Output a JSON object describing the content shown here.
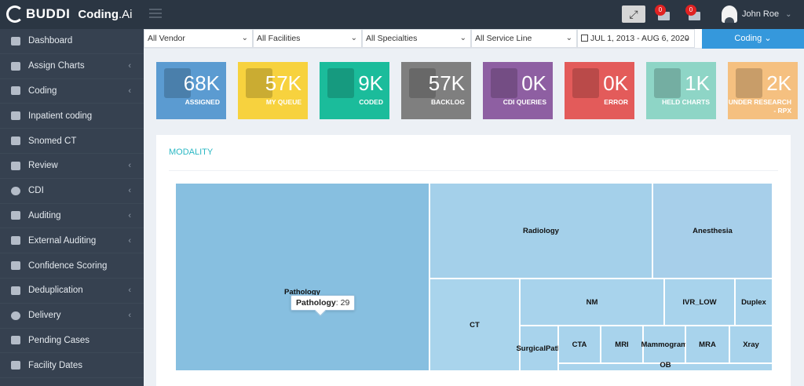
{
  "brand": {
    "name": "BUDDI",
    "product_main": "Coding",
    "product_suffix": ".Ai"
  },
  "header": {
    "notifications": [
      {
        "count": "0",
        "icon": "inbox-icon"
      },
      {
        "count": "0",
        "icon": "tasks-icon"
      }
    ],
    "user_name": "John Roe"
  },
  "sidebar": {
    "items": [
      {
        "label": "Dashboard",
        "icon": "dashboard-icon",
        "has_arrow": false
      },
      {
        "label": "Assign Charts",
        "icon": "list-icon",
        "has_arrow": true
      },
      {
        "label": "Coding",
        "icon": "check-square-icon",
        "has_arrow": true
      },
      {
        "label": "Inpatient coding",
        "icon": "file-icon",
        "has_arrow": false
      },
      {
        "label": "Snomed CT",
        "icon": "file-icon",
        "has_arrow": false
      },
      {
        "label": "Review",
        "icon": "edit-icon",
        "has_arrow": true
      },
      {
        "label": "CDI",
        "icon": "exclamation-circle-icon",
        "has_arrow": true
      },
      {
        "label": "Auditing",
        "icon": "thumbs-up-icon",
        "has_arrow": true
      },
      {
        "label": "External Auditing",
        "icon": "thumbs-up-icon",
        "has_arrow": true
      },
      {
        "label": "Confidence Scoring",
        "icon": "file-icon",
        "has_arrow": false
      },
      {
        "label": "Deduplication",
        "icon": "thumbs-up-icon",
        "has_arrow": true
      },
      {
        "label": "Delivery",
        "icon": "check-circle-icon",
        "has_arrow": true
      },
      {
        "label": "Pending Cases",
        "icon": "file-icon",
        "has_arrow": false
      },
      {
        "label": "Facility Dates",
        "icon": "calendar-icon",
        "has_arrow": false
      }
    ]
  },
  "filters": {
    "vendor": "All Vendor",
    "facilities": "All Facilities",
    "specialties": "All Specialties",
    "service_line": "All Service Line",
    "date_range": "JUL 1, 2013 - AUG 6, 2020",
    "coding_button": "Coding"
  },
  "tiles": [
    {
      "value": "68K",
      "label": "ASSIGNED",
      "color": "#5b9bd1"
    },
    {
      "value": "57K",
      "label": "MY QUEUE",
      "color": "#f7d23e"
    },
    {
      "value": "9K",
      "label": "CODED",
      "color": "#1bbc9b"
    },
    {
      "value": "57K",
      "label": "BACKLOG",
      "color": "#7f7f7f"
    },
    {
      "value": "0K",
      "label": "CDI QUERIES",
      "color": "#8e5fa2"
    },
    {
      "value": "0K",
      "label": "ERROR",
      "color": "#e35b5a"
    },
    {
      "value": "1K",
      "label": "HELD CHARTS",
      "color": "#8ed5c6"
    },
    {
      "value": "2K",
      "label": "UNDER RESEARCH - RPX",
      "color": "#f5c080"
    }
  ],
  "modality": {
    "title": "MODALITY",
    "tooltip": {
      "name": "Pathology",
      "value": "29"
    },
    "cells": [
      {
        "label": "Pathology",
        "color": "#87bfe0"
      },
      {
        "label": "Radiology",
        "color": "#a4d0ea"
      },
      {
        "label": "Anesthesia",
        "color": "#a7cfea"
      },
      {
        "label": "CT",
        "color": "#a9d4ec"
      },
      {
        "label": "NM",
        "color": "#a8d3ec"
      },
      {
        "label": "IVR_LOW",
        "color": "#a8d3ec"
      },
      {
        "label": "Duplex",
        "color": "#a8d3ec"
      },
      {
        "label": "SurgicalPath",
        "color": "#a8d3ec"
      },
      {
        "label": "CTA",
        "color": "#a8d3ec"
      },
      {
        "label": "MRI",
        "color": "#a8d3ec"
      },
      {
        "label": "Mammogram",
        "color": "#a8d3ec"
      },
      {
        "label": "MRA",
        "color": "#a8d3ec"
      },
      {
        "label": "Xray",
        "color": "#a8d3ec"
      },
      {
        "label": "OB",
        "color": "#a8d3ec"
      }
    ]
  }
}
